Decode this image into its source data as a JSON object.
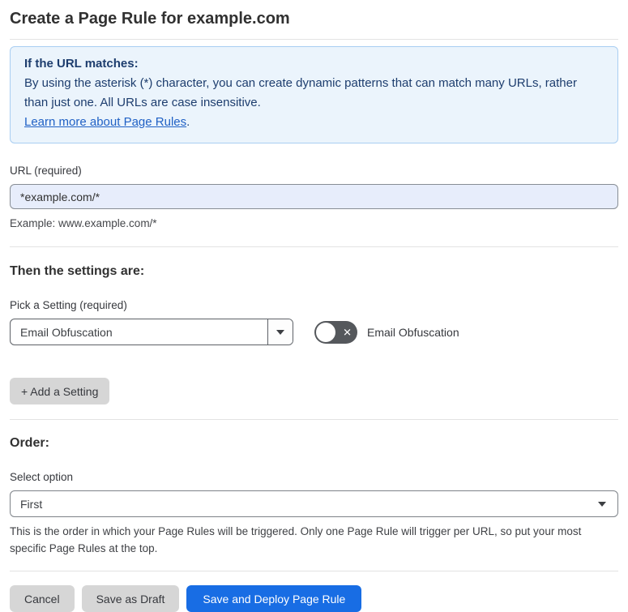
{
  "page": {
    "title": "Create a Page Rule for example.com"
  },
  "info_box": {
    "heading": "If the URL matches:",
    "body": "By using the asterisk (*) character, you can create dynamic patterns that can match many URLs, rather than just one. All URLs are case insensitive.",
    "link": "Learn more about Page Rules",
    "link_suffix": "."
  },
  "url_field": {
    "label": "URL (required)",
    "value": "*example.com/*",
    "example": "Example: www.example.com/*"
  },
  "settings_section": {
    "heading": "Then the settings are:",
    "pick_label": "Pick a Setting (required)",
    "selected_setting": "Email Obfuscation",
    "toggle": {
      "label": "Email Obfuscation",
      "state": "off",
      "icon": "x-icon",
      "x_glyph": "✕"
    },
    "add_button_label": "+ Add a Setting"
  },
  "order_section": {
    "heading": "Order:",
    "select_label": "Select option",
    "selected_value": "First",
    "help": "This is the order in which your Page Rules will be triggered. Only one Page Rule will trigger per URL, so put your most specific Page Rules at the top."
  },
  "footer": {
    "cancel_label": "Cancel",
    "save_draft_label": "Save as Draft",
    "save_deploy_label": "Save and Deploy Page Rule"
  },
  "colors": {
    "primary_blue": "#186de4",
    "info_bg": "#ebf4fc",
    "info_border": "#a9cef2",
    "info_text": "#1d3d6e",
    "link_blue": "#2061c5",
    "input_bg": "#e7edfb",
    "gray_button": "#d6d6d6",
    "toggle_off": "#55585c"
  }
}
